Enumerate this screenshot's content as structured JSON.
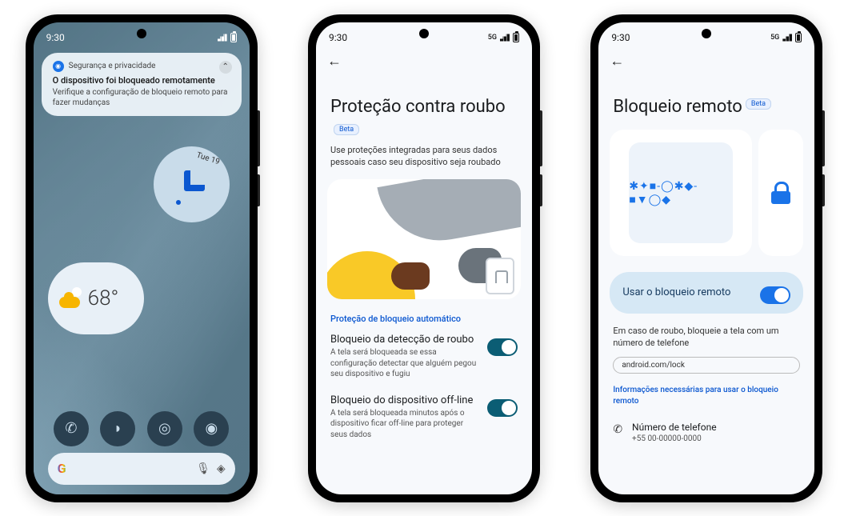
{
  "status": {
    "time": "9:30",
    "net": "5G"
  },
  "phone1": {
    "notif": {
      "app": "Segurança e privacidade",
      "title": "O dispositivo foi bloqueado remotamente",
      "body": "Verifique a configuração de bloqueio remoto para fazer mudanças"
    },
    "date": "Tue 19",
    "temp": "68°",
    "search": "G"
  },
  "phone2": {
    "title": "Proteção contra roubo",
    "beta": "Beta",
    "subtitle": "Use proteções integradas para seus dados pessoais caso seu dispositivo seja roubado",
    "section": "Proteção de bloqueio automático",
    "settings": [
      {
        "title": "Bloqueio da detecção de roubo",
        "desc": "A tela será bloqueada se essa configuração detectar que alguém pegou seu dispositivo e fugiu"
      },
      {
        "title": "Bloqueio do dispositivo off-line",
        "desc": "A tela será bloqueada minutos após o dispositivo ficar off-line para proteger seus dados"
      }
    ]
  },
  "phone3": {
    "title": "Bloqueio remoto",
    "beta": "Beta",
    "masked": "✱✦■-◯✱◆-■▼◯◆",
    "useRemote": "Usar o bloqueio remoto",
    "caption": "Em caso de roubo, bloqueie a tela com um número de telefone",
    "url": "android.com/lock",
    "link": "Informações necessárias para usar o bloqueio remoto",
    "phoneTitle": "Número de telefone",
    "phoneVal": "+55 00-00000-0000"
  }
}
